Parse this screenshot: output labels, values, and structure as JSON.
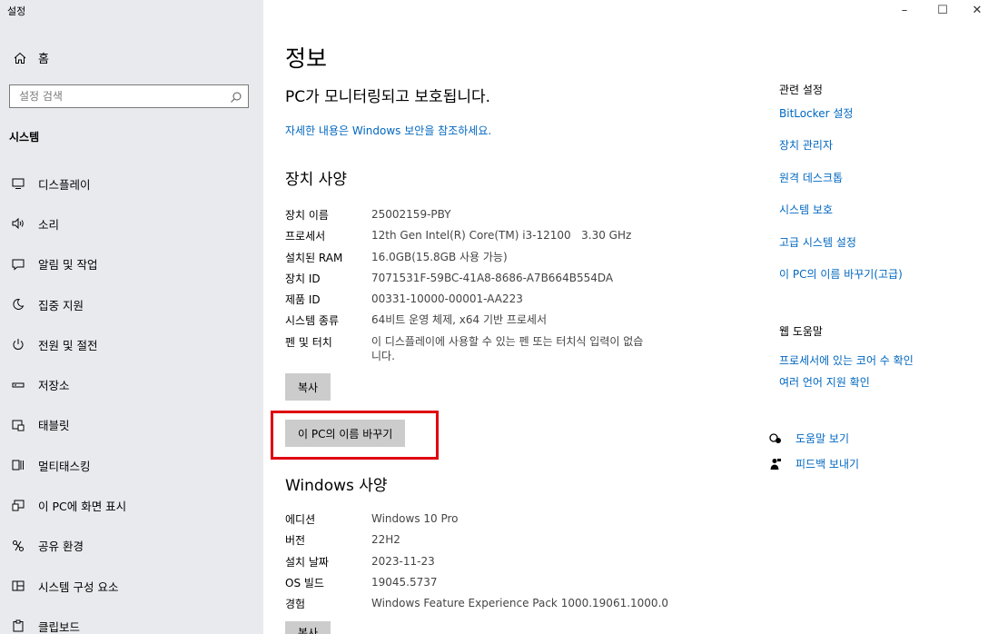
{
  "app_title": "설정",
  "window_controls": {
    "minimize": "–",
    "maximize": "☐",
    "close": "✕"
  },
  "sidebar": {
    "home": "홈",
    "search_placeholder": "설정 검색",
    "section": "시스템",
    "items": [
      {
        "label": "디스플레이",
        "icon": "display-icon"
      },
      {
        "label": "소리",
        "icon": "sound-icon"
      },
      {
        "label": "알림 및 작업",
        "icon": "notification-icon"
      },
      {
        "label": "집중 지원",
        "icon": "focus-assist-icon"
      },
      {
        "label": "전원 및 절전",
        "icon": "power-icon"
      },
      {
        "label": "저장소",
        "icon": "storage-icon"
      },
      {
        "label": "태블릿",
        "icon": "tablet-icon"
      },
      {
        "label": "멀티태스킹",
        "icon": "multitasking-icon"
      },
      {
        "label": "이 PC에 화면 표시",
        "icon": "project-icon"
      },
      {
        "label": "공유 환경",
        "icon": "shared-experience-icon"
      },
      {
        "label": "시스템 구성 요소",
        "icon": "system-components-icon"
      },
      {
        "label": "클립보드",
        "icon": "clipboard-icon"
      }
    ]
  },
  "main": {
    "title": "정보",
    "protect_title": "PC가 모니터링되고 보호됩니다.",
    "protect_link": "자세한 내용은 Windows 보안을 참조하세요.",
    "device_specs_title": "장치 사양",
    "device_specs": [
      {
        "key": "장치 이름",
        "value": "25002159-PBY"
      },
      {
        "key": "프로세서",
        "value": "12th Gen Intel(R) Core(TM) i3-12100   3.30 GHz"
      },
      {
        "key": "설치된 RAM",
        "value": "16.0GB(15.8GB 사용 가능)"
      },
      {
        "key": "장치 ID",
        "value": "7071531F-59BC-41A8-8686-A7B664B554DA"
      },
      {
        "key": "제품 ID",
        "value": "00331-10000-00001-AA223"
      },
      {
        "key": "시스템 종류",
        "value": "64비트 운영 체제, x64 기반 프로세서"
      },
      {
        "key": "펜 및 터치",
        "value": "이 디스플레이에 사용할 수 있는 펜 또는 터치식 입력이 없습니다."
      }
    ],
    "copy_button": "복사",
    "rename_button": "이 PC의 이름 바꾸기",
    "windows_specs_title": "Windows 사양",
    "windows_specs": [
      {
        "key": "에디션",
        "value": "Windows 10 Pro"
      },
      {
        "key": "버전",
        "value": "22H2"
      },
      {
        "key": "설치 날짜",
        "value": "2023-11-23"
      },
      {
        "key": "OS 빌드",
        "value": "19045.5737"
      },
      {
        "key": "경험",
        "value": "Windows Feature Experience Pack 1000.19061.1000.0"
      }
    ],
    "copy_button_2": "복사"
  },
  "right": {
    "related_title": "관련 설정",
    "related_links": [
      "BitLocker 설정",
      "장치 관리자",
      "원격 데스크톱",
      "시스템 보호",
      "고급 시스템 설정",
      "이 PC의 이름 바꾸기(고급)"
    ],
    "web_help_title": "웹 도움말",
    "web_help_links": [
      "프로세서에 있는 코어 수 확인",
      "여러 언어 지원 확인"
    ],
    "help_link": "도움말 보기",
    "feedback_link": "피드백 보내기"
  },
  "colors": {
    "sidebar_bg": "#e9eaee",
    "link": "#0067c0",
    "button_bg": "#cccccc",
    "highlight": "#e0000f"
  }
}
